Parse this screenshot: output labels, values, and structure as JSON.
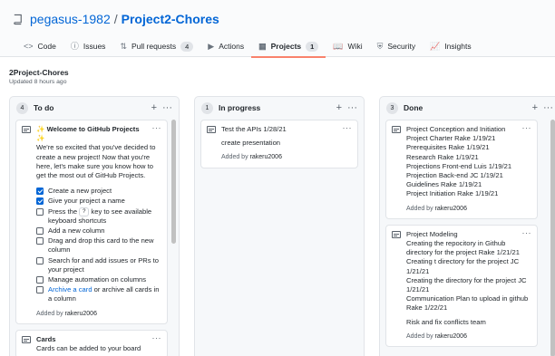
{
  "repo": {
    "owner": "pegasus-1982",
    "separator": "/",
    "name": "Project2-Chores"
  },
  "tabs": [
    {
      "label": "Code",
      "icon": "<>"
    },
    {
      "label": "Issues",
      "icon": "ⓘ"
    },
    {
      "label": "Pull requests",
      "icon": "⇅",
      "count": "4"
    },
    {
      "label": "Actions",
      "icon": "▶"
    },
    {
      "label": "Projects",
      "icon": "▦",
      "count": "1",
      "active": true
    },
    {
      "label": "Wiki",
      "icon": "📖"
    },
    {
      "label": "Security",
      "icon": "⛨"
    },
    {
      "label": "Insights",
      "icon": "📈"
    }
  ],
  "project": {
    "name": "2Project-Chores",
    "updated": "Updated 8 hours ago"
  },
  "columns": [
    {
      "count": "4",
      "title": "To do",
      "cards": [
        {
          "title": "Welcome to GitHub Projects",
          "sparkle": "✨",
          "intro": "We're so excited that you've decided to create a new project! Now that you're here, let's make sure you know how to get the most out of GitHub Projects.",
          "checklist": [
            {
              "checked": true,
              "text": "Create a new project"
            },
            {
              "checked": true,
              "text": "Give your project a name"
            },
            {
              "checked": false,
              "before": "Press the",
              "key": "?",
              "after": "key to see available keyboard shortcuts"
            },
            {
              "checked": false,
              "text": "Add a new column"
            },
            {
              "checked": false,
              "text": "Drag and drop this card to the new column"
            },
            {
              "checked": false,
              "text": "Search for and add issues or PRs to your project"
            },
            {
              "checked": false,
              "text": "Manage automation on columns"
            },
            {
              "checked": false,
              "link": "Archive a card",
              "after": "or archive all cards in a column"
            }
          ],
          "added_prefix": "Added by",
          "added_by": "rakeru2006"
        },
        {
          "title": "Cards",
          "body": "Cards can be added to your board"
        }
      ]
    },
    {
      "count": "1",
      "title": "In progress",
      "cards": [
        {
          "lines": [
            "Test the APIs 1/28/21"
          ],
          "extra": "create presentation",
          "added_prefix": "Added by",
          "added_by": "rakeru2006"
        }
      ]
    },
    {
      "count": "3",
      "title": "Done",
      "cards": [
        {
          "lines": [
            "Project Conception and Initiation",
            "Project Charter Rake 1/19/21",
            "Prerequisites Rake 1/19/21",
            "Research Rake 1/19/21",
            "Projections Front-end Luis 1/19/21",
            "Projection Back-end JC 1/19/21",
            "Guidelines Rake 1/19/21",
            "Project Initiation Rake 1/19/21"
          ],
          "added_prefix": "Added by",
          "added_by": "rakeru2006"
        },
        {
          "lines": [
            "Project Modeling",
            "Creating the repocitory in Github directory for the project Rake 1/21/21",
            "Creating t directory for the project JC 1/21/21",
            "Creating the directory for the project JC 1/21/21",
            "Communication Plan to upload in github Rake 1/22/21"
          ],
          "extra": "Risk and fix conflicts team",
          "added_prefix": "Added by",
          "added_by": "rakeru2006"
        }
      ]
    }
  ],
  "icons": {
    "repo": "book-icon",
    "add": "plus-icon",
    "menu": "kebab-icon",
    "note": "note-icon"
  },
  "colors": {
    "link": "#0366d6",
    "active_tab": "#f9826c",
    "column_bg": "#f6f8fa"
  }
}
